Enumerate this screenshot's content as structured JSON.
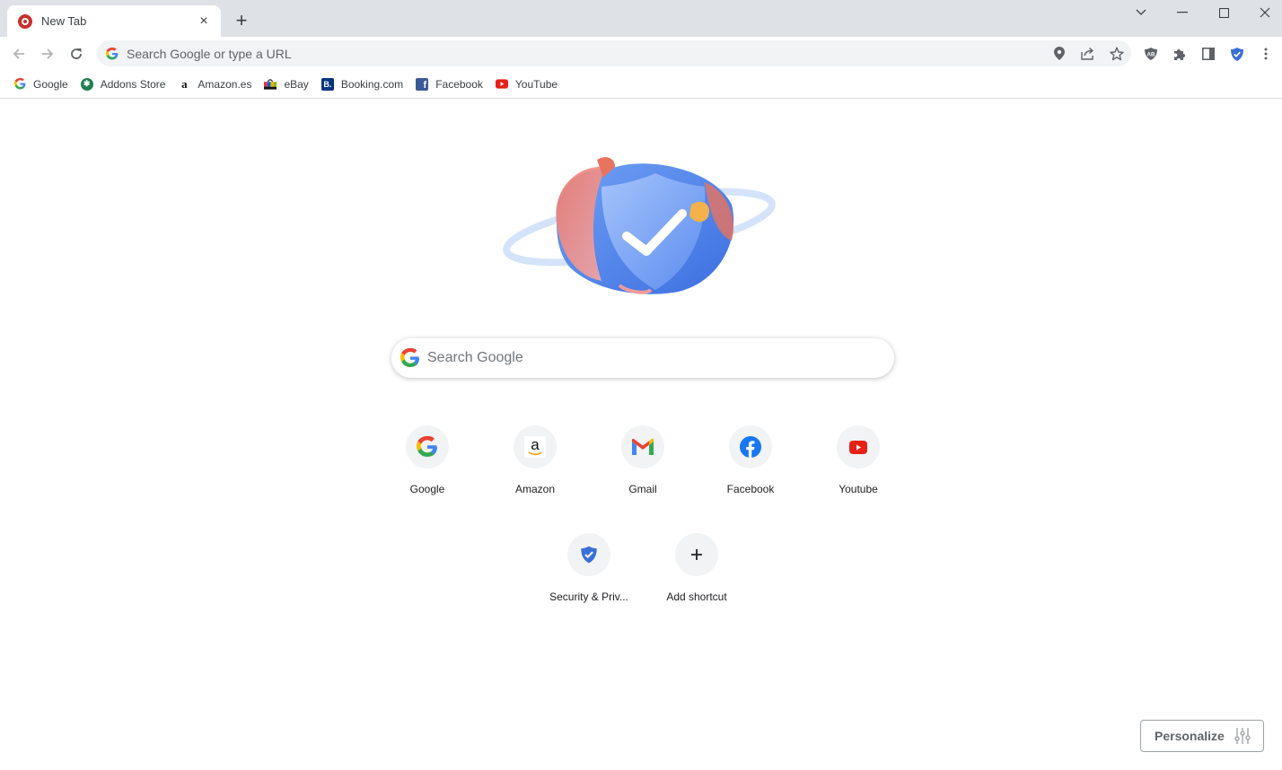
{
  "tab": {
    "title": "New Tab",
    "close_label": "×",
    "new_tab_label": "+"
  },
  "window_controls": {
    "tab_search": "⌄",
    "minimize": "—",
    "maximize": "☐",
    "close": "✕"
  },
  "omnibox": {
    "placeholder": "Search Google or type a URL",
    "value": ""
  },
  "bookmarks": [
    {
      "label": "Google",
      "icon": "google-icon"
    },
    {
      "label": "Addons Store",
      "icon": "addons-store-icon"
    },
    {
      "label": "Amazon.es",
      "icon": "amazon-icon"
    },
    {
      "label": "eBay",
      "icon": "ebay-icon"
    },
    {
      "label": "Booking.com",
      "icon": "booking-icon"
    },
    {
      "label": "Facebook",
      "icon": "facebook-icon"
    },
    {
      "label": "YouTube",
      "icon": "youtube-icon"
    }
  ],
  "search": {
    "placeholder": "Search Google",
    "value": ""
  },
  "shortcuts": [
    {
      "label": "Google",
      "icon": "google-icon"
    },
    {
      "label": "Amazon",
      "icon": "amazon-icon"
    },
    {
      "label": "Gmail",
      "icon": "gmail-icon"
    },
    {
      "label": "Facebook",
      "icon": "facebook-icon"
    },
    {
      "label": "Youtube",
      "icon": "youtube-icon"
    },
    {
      "label": "Security & Priv...",
      "icon": "security-shield-icon"
    },
    {
      "label": "Add shortcut",
      "icon": "plus-icon"
    }
  ],
  "personalize": {
    "label": "Personalize"
  },
  "colors": {
    "accent_blue": "#1a73e8",
    "titlebar": "#dee1e6",
    "omnibox_bg": "#f1f3f4"
  }
}
